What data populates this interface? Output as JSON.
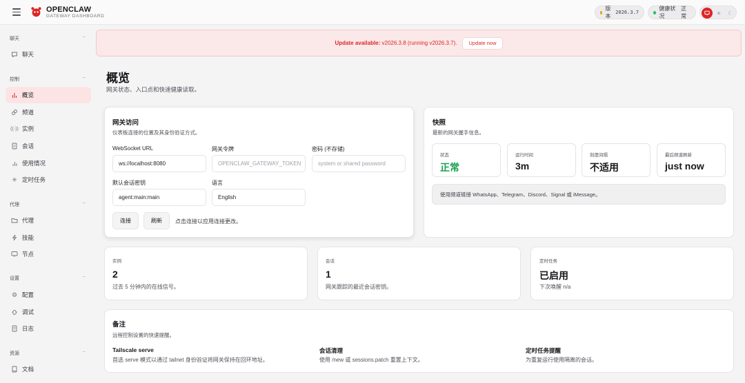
{
  "brand": {
    "title": "OPENCLAW",
    "subtitle": "GATEWAY DASHBOARD"
  },
  "header": {
    "version_label": "版本",
    "version_value": "2026.3.7",
    "health_label": "健康状况",
    "health_value": "正常",
    "colors": {
      "version_dot": "#f59e0b",
      "health_dot": "#22c55e",
      "accent": "#dc2626"
    }
  },
  "sidebar": {
    "sections": [
      {
        "title": "聊天",
        "items": [
          {
            "label": "聊天",
            "icon": "chat-icon"
          }
        ]
      },
      {
        "title": "控制",
        "items": [
          {
            "label": "概览",
            "icon": "bar-chart-icon",
            "active": true
          },
          {
            "label": "频道",
            "icon": "link-icon"
          },
          {
            "label": "实例",
            "icon": "broadcast-icon"
          },
          {
            "label": "会话",
            "icon": "document-icon"
          },
          {
            "label": "使用情况",
            "icon": "usage-chart-icon"
          },
          {
            "label": "定时任务",
            "icon": "loader-icon"
          }
        ]
      },
      {
        "title": "代理",
        "items": [
          {
            "label": "代理",
            "icon": "folder-icon"
          },
          {
            "label": "技能",
            "icon": "bolt-icon"
          },
          {
            "label": "节点",
            "icon": "monitor-icon"
          }
        ]
      },
      {
        "title": "设置",
        "items": [
          {
            "label": "配置",
            "icon": "gear-icon"
          },
          {
            "label": "调试",
            "icon": "bug-icon"
          },
          {
            "label": "日志",
            "icon": "scroll-icon"
          }
        ]
      },
      {
        "title": "资源",
        "items": [
          {
            "label": "文档",
            "icon": "book-icon"
          }
        ]
      }
    ]
  },
  "banner": {
    "prefix": "Update available:",
    "text": " v2026.3.8 (running v2026.3.7).",
    "button": "Update now"
  },
  "page": {
    "title": "概览",
    "subtitle": "网关状态、入口点和快速健康读取。"
  },
  "gateway": {
    "title": "网关访问",
    "subtitle": "仪表板连接的位置及其身份验证方式。",
    "ws_label": "WebSocket URL",
    "ws_value": "ws://localhost:8080",
    "token_label": "网关令牌",
    "token_placeholder": "OPENCLAW_GATEWAY_TOKEN",
    "password_label": "密码 (不存储)",
    "password_placeholder": "system or shared password",
    "session_label": "默认会话密钥",
    "session_value": "agent:main:main",
    "lang_label": "语言",
    "lang_value": "English",
    "connect": "连接",
    "refresh": "刷新",
    "hint": "点击连接以应用连接更改。"
  },
  "snapshot": {
    "title": "快照",
    "subtitle": "最新的网关握手信息。",
    "stats": [
      {
        "label": "状态",
        "value": "正常"
      },
      {
        "label": "运行时间",
        "value": "3m"
      },
      {
        "label": "刻度间隔",
        "value": "不适用"
      },
      {
        "label": "最后频道刷新",
        "value": "just now"
      }
    ],
    "note": "使用频道链接 WhatsApp、Telegram、Discord、Signal 或 iMessage。"
  },
  "metrics": [
    {
      "label": "实例",
      "value": "2",
      "sub": "过去 5 分钟内的在线信号。"
    },
    {
      "label": "会话",
      "value": "1",
      "sub": "网关跟踪的最近会话密钥。"
    },
    {
      "label": "定时任务",
      "value": "已启用",
      "sub": "下次唤醒 n/a"
    }
  ],
  "notes": {
    "title": "备注",
    "subtitle": "远程控制设置的快速提醒。",
    "items": [
      {
        "title": "Tailscale serve",
        "text": "首选 serve 模式以通过 tailnet 身份验证将网关保持在回环地址。"
      },
      {
        "title": "会话清理",
        "text": "使用 /new 或 sessions.patch 重置上下文。"
      },
      {
        "title": "定时任务提醒",
        "text": "为重复运行使用隔离的会话。"
      }
    ]
  }
}
